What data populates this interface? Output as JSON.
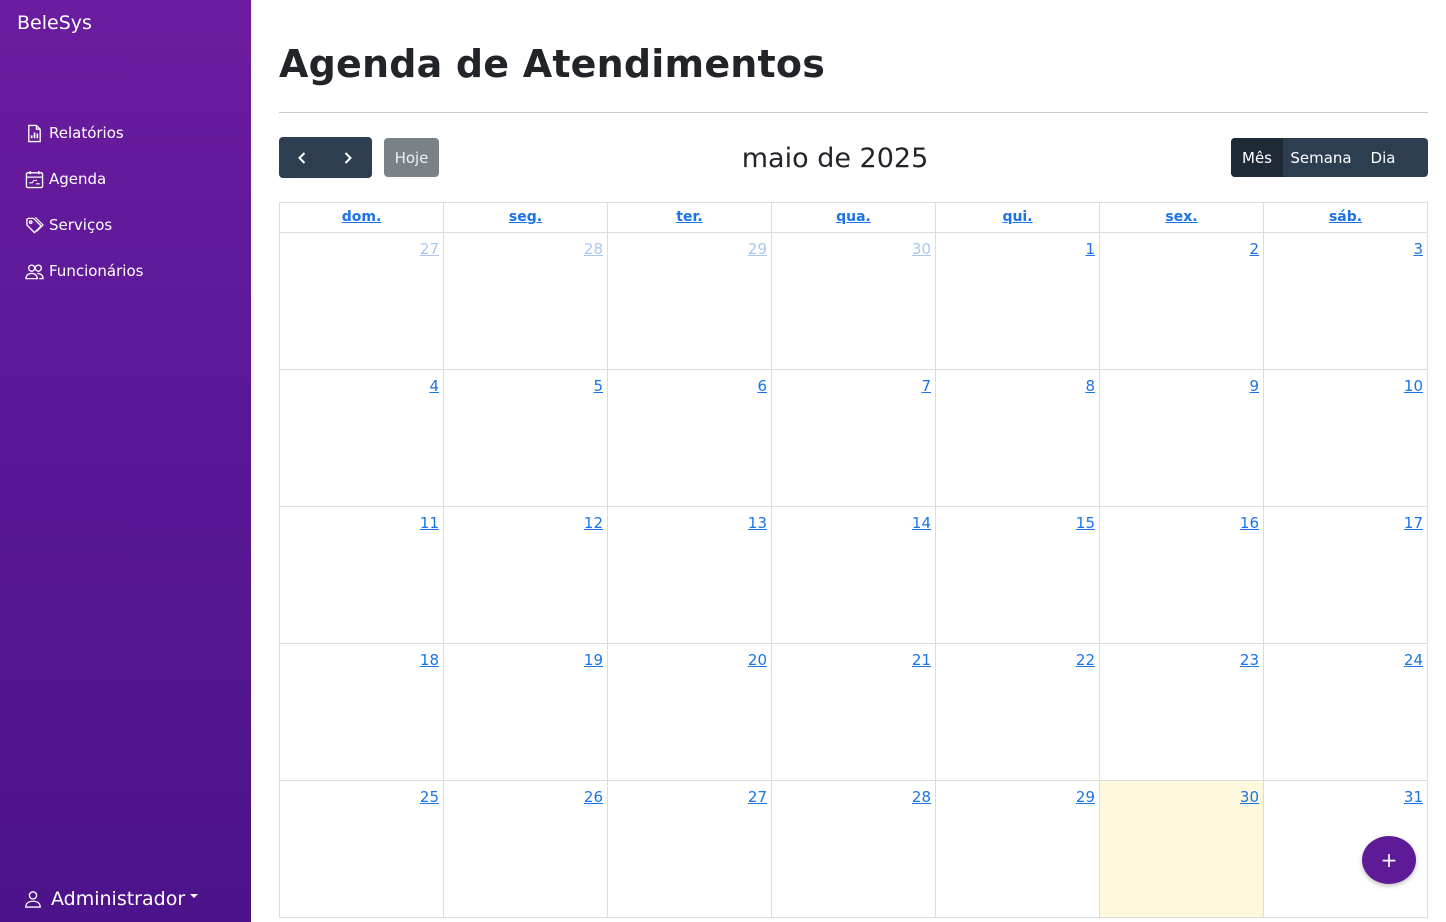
{
  "sidebar": {
    "brand": "BeleSys",
    "items": [
      {
        "label": "Relatórios",
        "icon": "report-icon"
      },
      {
        "label": "Agenda",
        "icon": "calendar-icon"
      },
      {
        "label": "Serviços",
        "icon": "tag-icon"
      },
      {
        "label": "Funcionários",
        "icon": "people-icon"
      }
    ],
    "user": {
      "label": "Administrador",
      "icon": "person-icon"
    }
  },
  "page": {
    "title": "Agenda de Atendimentos"
  },
  "toolbar": {
    "prev_icon": "chevron-left-icon",
    "next_icon": "chevron-right-icon",
    "today_label": "Hoje",
    "title": "maio de 2025",
    "views": [
      {
        "label": "Mês",
        "active": true
      },
      {
        "label": "Semana",
        "active": false
      },
      {
        "label": "Dia",
        "active": false
      }
    ]
  },
  "calendar": {
    "weekdays": [
      "dom.",
      "seg.",
      "ter.",
      "qua.",
      "qui.",
      "sex.",
      "sáb."
    ],
    "weeks": [
      [
        {
          "d": "27",
          "other": true
        },
        {
          "d": "28",
          "other": true
        },
        {
          "d": "29",
          "other": true
        },
        {
          "d": "30",
          "other": true
        },
        {
          "d": "1"
        },
        {
          "d": "2"
        },
        {
          "d": "3"
        }
      ],
      [
        {
          "d": "4"
        },
        {
          "d": "5"
        },
        {
          "d": "6"
        },
        {
          "d": "7"
        },
        {
          "d": "8"
        },
        {
          "d": "9"
        },
        {
          "d": "10"
        }
      ],
      [
        {
          "d": "11"
        },
        {
          "d": "12"
        },
        {
          "d": "13"
        },
        {
          "d": "14"
        },
        {
          "d": "15"
        },
        {
          "d": "16"
        },
        {
          "d": "17"
        }
      ],
      [
        {
          "d": "18"
        },
        {
          "d": "19"
        },
        {
          "d": "20"
        },
        {
          "d": "21"
        },
        {
          "d": "22"
        },
        {
          "d": "23"
        },
        {
          "d": "24"
        }
      ],
      [
        {
          "d": "25"
        },
        {
          "d": "26"
        },
        {
          "d": "27"
        },
        {
          "d": "28"
        },
        {
          "d": "29"
        },
        {
          "d": "30",
          "today": true
        },
        {
          "d": "31"
        }
      ]
    ]
  },
  "fab": {
    "label": "+"
  },
  "colors": {
    "sidebar_top": "#6c1c9e",
    "sidebar_bottom": "#4c138a",
    "link": "#1a73e8",
    "today_highlight": "#fef8dd",
    "toolbar_button": "#2c3e50",
    "fab": "#5e1a97"
  }
}
